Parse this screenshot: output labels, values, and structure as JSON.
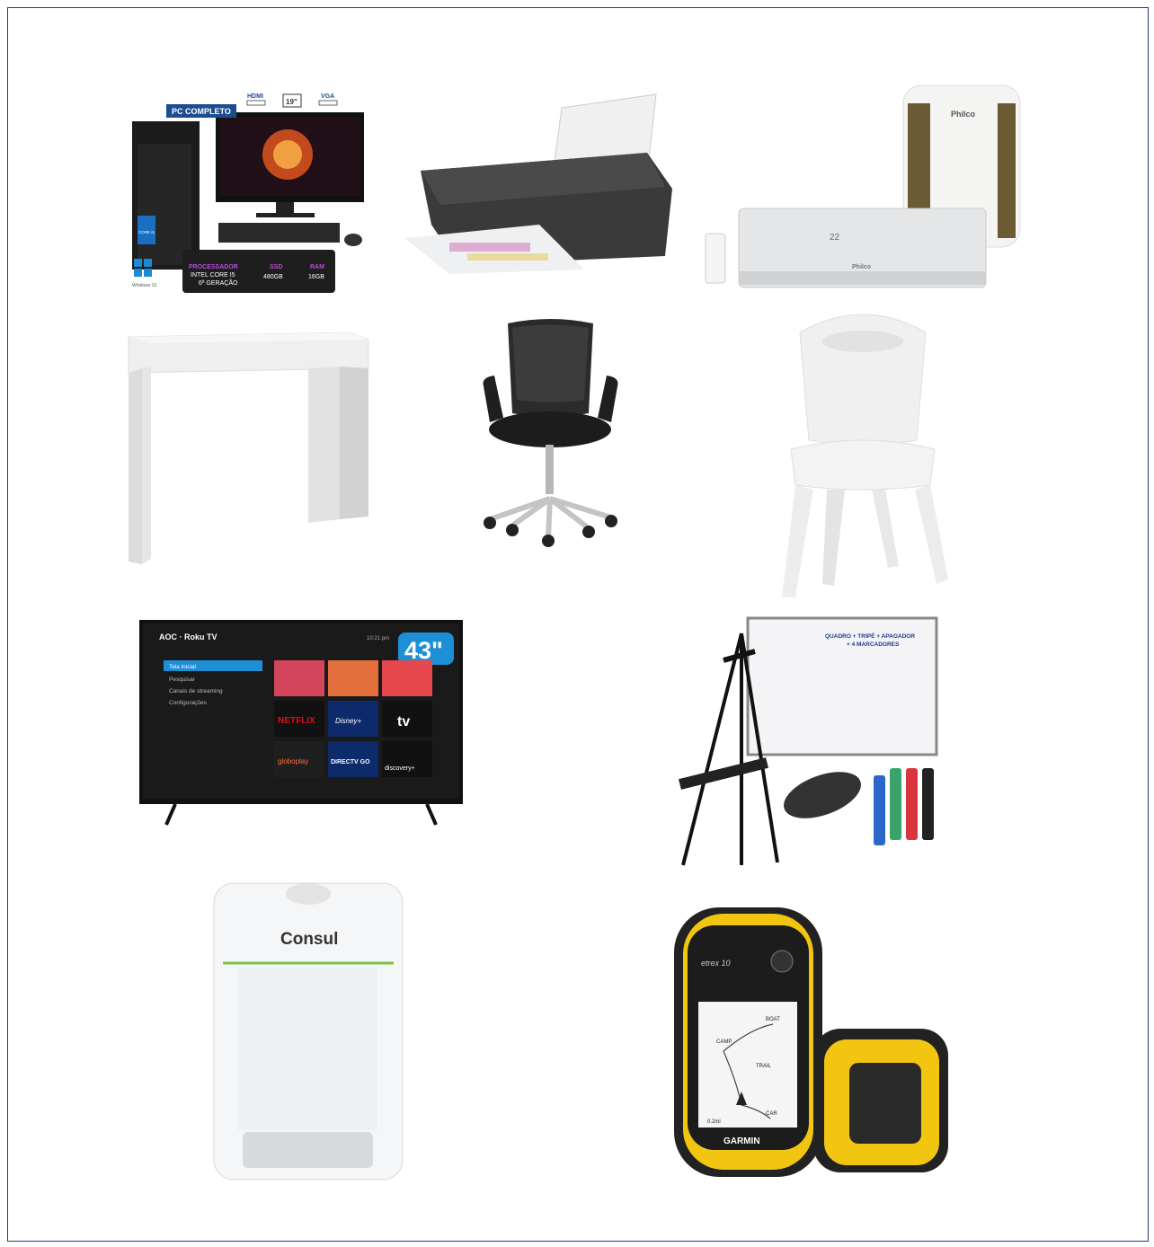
{
  "products": {
    "pc": {
      "badge": "PC COMPLETO",
      "hdmi": "HDMI",
      "size": "19\"",
      "vga": "VGA",
      "cpu_title": "PROCESSADOR",
      "cpu_value": "INTEL CORE I5",
      "cpu_gen": "6ª GERAÇÃO",
      "ssd_title": "SSD",
      "ssd_value": "480GB",
      "ram_title": "RAM",
      "ram_value": "16GB",
      "intel_chip": "CORE i5",
      "windows": "Windows 10"
    },
    "air_conditioner": {
      "brand_outdoor": "Philco",
      "brand_indoor": "Philco",
      "display": "22"
    },
    "tv": {
      "brand": "AOC · Roku TV",
      "time": "10:21 pm",
      "size_badge": "43\"",
      "menu": [
        "Tela inicial",
        "Pesquisar",
        "Canais de streaming",
        "Configurações"
      ],
      "apps": [
        "NETFLIX",
        "Disney+",
        "tv",
        "globoplay",
        "DIRECTV GO",
        "discovery+"
      ]
    },
    "whiteboard": {
      "caption_line1": "QUADRO + TRIPÉ + APAGADOR",
      "caption_line2": "+ 4 MARCADORES"
    },
    "water_purifier": {
      "brand": "Consul"
    },
    "gps": {
      "model": "etrex 10",
      "brand": "GARMIN",
      "map_labels": [
        "BOAT",
        "CAMP",
        "TRAIL",
        "CAR"
      ],
      "scale": "0.2mi"
    }
  }
}
